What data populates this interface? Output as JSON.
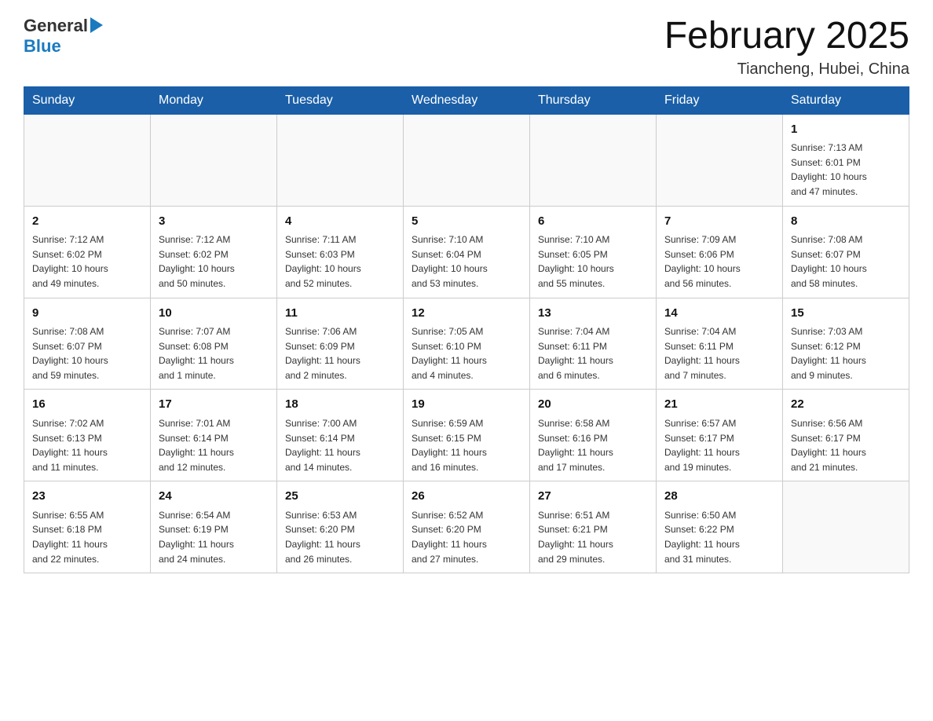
{
  "header": {
    "logo": {
      "general": "General",
      "blue": "Blue"
    },
    "title": "February 2025",
    "subtitle": "Tiancheng, Hubei, China"
  },
  "weekdays": [
    "Sunday",
    "Monday",
    "Tuesday",
    "Wednesday",
    "Thursday",
    "Friday",
    "Saturday"
  ],
  "weeks": [
    [
      {
        "day": "",
        "info": ""
      },
      {
        "day": "",
        "info": ""
      },
      {
        "day": "",
        "info": ""
      },
      {
        "day": "",
        "info": ""
      },
      {
        "day": "",
        "info": ""
      },
      {
        "day": "",
        "info": ""
      },
      {
        "day": "1",
        "info": "Sunrise: 7:13 AM\nSunset: 6:01 PM\nDaylight: 10 hours\nand 47 minutes."
      }
    ],
    [
      {
        "day": "2",
        "info": "Sunrise: 7:12 AM\nSunset: 6:02 PM\nDaylight: 10 hours\nand 49 minutes."
      },
      {
        "day": "3",
        "info": "Sunrise: 7:12 AM\nSunset: 6:02 PM\nDaylight: 10 hours\nand 50 minutes."
      },
      {
        "day": "4",
        "info": "Sunrise: 7:11 AM\nSunset: 6:03 PM\nDaylight: 10 hours\nand 52 minutes."
      },
      {
        "day": "5",
        "info": "Sunrise: 7:10 AM\nSunset: 6:04 PM\nDaylight: 10 hours\nand 53 minutes."
      },
      {
        "day": "6",
        "info": "Sunrise: 7:10 AM\nSunset: 6:05 PM\nDaylight: 10 hours\nand 55 minutes."
      },
      {
        "day": "7",
        "info": "Sunrise: 7:09 AM\nSunset: 6:06 PM\nDaylight: 10 hours\nand 56 minutes."
      },
      {
        "day": "8",
        "info": "Sunrise: 7:08 AM\nSunset: 6:07 PM\nDaylight: 10 hours\nand 58 minutes."
      }
    ],
    [
      {
        "day": "9",
        "info": "Sunrise: 7:08 AM\nSunset: 6:07 PM\nDaylight: 10 hours\nand 59 minutes."
      },
      {
        "day": "10",
        "info": "Sunrise: 7:07 AM\nSunset: 6:08 PM\nDaylight: 11 hours\nand 1 minute."
      },
      {
        "day": "11",
        "info": "Sunrise: 7:06 AM\nSunset: 6:09 PM\nDaylight: 11 hours\nand 2 minutes."
      },
      {
        "day": "12",
        "info": "Sunrise: 7:05 AM\nSunset: 6:10 PM\nDaylight: 11 hours\nand 4 minutes."
      },
      {
        "day": "13",
        "info": "Sunrise: 7:04 AM\nSunset: 6:11 PM\nDaylight: 11 hours\nand 6 minutes."
      },
      {
        "day": "14",
        "info": "Sunrise: 7:04 AM\nSunset: 6:11 PM\nDaylight: 11 hours\nand 7 minutes."
      },
      {
        "day": "15",
        "info": "Sunrise: 7:03 AM\nSunset: 6:12 PM\nDaylight: 11 hours\nand 9 minutes."
      }
    ],
    [
      {
        "day": "16",
        "info": "Sunrise: 7:02 AM\nSunset: 6:13 PM\nDaylight: 11 hours\nand 11 minutes."
      },
      {
        "day": "17",
        "info": "Sunrise: 7:01 AM\nSunset: 6:14 PM\nDaylight: 11 hours\nand 12 minutes."
      },
      {
        "day": "18",
        "info": "Sunrise: 7:00 AM\nSunset: 6:14 PM\nDaylight: 11 hours\nand 14 minutes."
      },
      {
        "day": "19",
        "info": "Sunrise: 6:59 AM\nSunset: 6:15 PM\nDaylight: 11 hours\nand 16 minutes."
      },
      {
        "day": "20",
        "info": "Sunrise: 6:58 AM\nSunset: 6:16 PM\nDaylight: 11 hours\nand 17 minutes."
      },
      {
        "day": "21",
        "info": "Sunrise: 6:57 AM\nSunset: 6:17 PM\nDaylight: 11 hours\nand 19 minutes."
      },
      {
        "day": "22",
        "info": "Sunrise: 6:56 AM\nSunset: 6:17 PM\nDaylight: 11 hours\nand 21 minutes."
      }
    ],
    [
      {
        "day": "23",
        "info": "Sunrise: 6:55 AM\nSunset: 6:18 PM\nDaylight: 11 hours\nand 22 minutes."
      },
      {
        "day": "24",
        "info": "Sunrise: 6:54 AM\nSunset: 6:19 PM\nDaylight: 11 hours\nand 24 minutes."
      },
      {
        "day": "25",
        "info": "Sunrise: 6:53 AM\nSunset: 6:20 PM\nDaylight: 11 hours\nand 26 minutes."
      },
      {
        "day": "26",
        "info": "Sunrise: 6:52 AM\nSunset: 6:20 PM\nDaylight: 11 hours\nand 27 minutes."
      },
      {
        "day": "27",
        "info": "Sunrise: 6:51 AM\nSunset: 6:21 PM\nDaylight: 11 hours\nand 29 minutes."
      },
      {
        "day": "28",
        "info": "Sunrise: 6:50 AM\nSunset: 6:22 PM\nDaylight: 11 hours\nand 31 minutes."
      },
      {
        "day": "",
        "info": ""
      }
    ]
  ]
}
